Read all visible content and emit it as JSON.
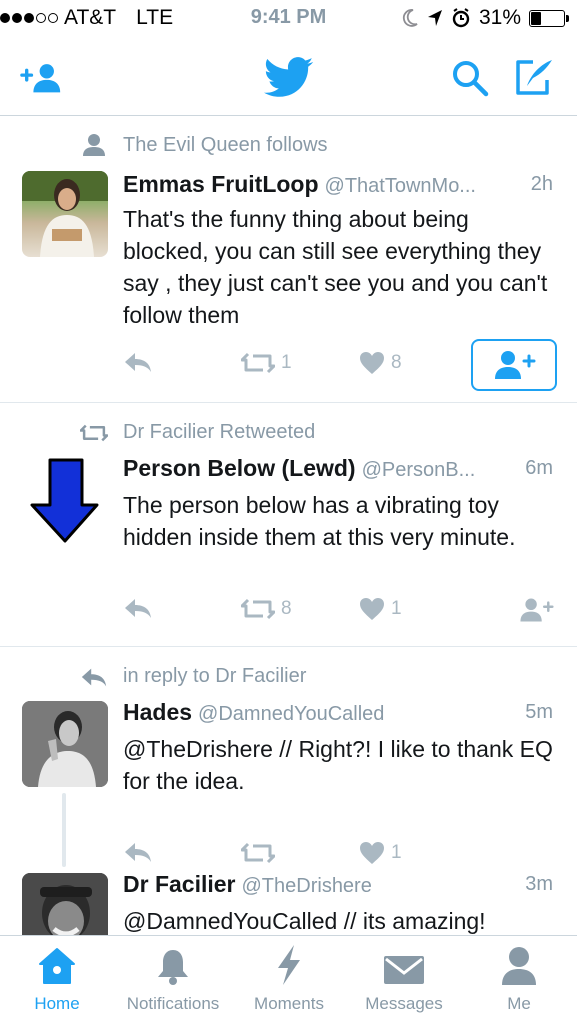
{
  "status_bar": {
    "carrier": "AT&T",
    "network": "LTE",
    "time": "9:41 PM",
    "battery": "31%",
    "battery_level": 0.31
  },
  "colors": {
    "accent": "#1da1f2",
    "muted": "#8899a6",
    "action": "#aab8c2",
    "arrow": "#1230d8"
  },
  "nav": {
    "left_icon": "add-user-icon",
    "center_icon": "twitter-bird-logo",
    "search_icon": "search-icon",
    "compose_icon": "compose-icon"
  },
  "tweets": [
    {
      "social_context": "The Evil Queen follows",
      "social_icon": "person-icon",
      "name": "Emmas FruitLoop",
      "handle": "@ThatTownMo...",
      "time": "2h",
      "text": "That's the funny thing about being blocked, you can still see everything they say , they just can't see you and you can't follow them",
      "retweets": "1",
      "likes": "8"
    },
    {
      "social_context": "Dr Facilier Retweeted",
      "social_icon": "retweet-icon",
      "name": "Person Below (Lewd)",
      "handle": "@PersonB...",
      "time": "6m",
      "text": "The person below has a vibrating toy hidden inside them at this very minute.",
      "retweets": "8",
      "likes": "1"
    },
    {
      "social_context": "in reply to Dr Facilier",
      "social_icon": "reply-icon",
      "name": "Hades",
      "handle": "@DamnedYouCalled",
      "time": "5m",
      "text": "@TheDrishere // Right?! I like to thank EQ for the idea.",
      "retweets": "",
      "likes": "1"
    },
    {
      "name": "Dr Facilier",
      "handle": "@TheDrishere",
      "time": "3m",
      "text": "@DamnedYouCalled // its amazing!"
    }
  ],
  "tabs": [
    {
      "label": "Home",
      "icon": "home-icon",
      "active": true
    },
    {
      "label": "Notifications",
      "icon": "bell-icon",
      "active": false
    },
    {
      "label": "Moments",
      "icon": "lightning-icon",
      "active": false
    },
    {
      "label": "Messages",
      "icon": "envelope-icon",
      "active": false
    },
    {
      "label": "Me",
      "icon": "person-icon",
      "active": false
    }
  ]
}
